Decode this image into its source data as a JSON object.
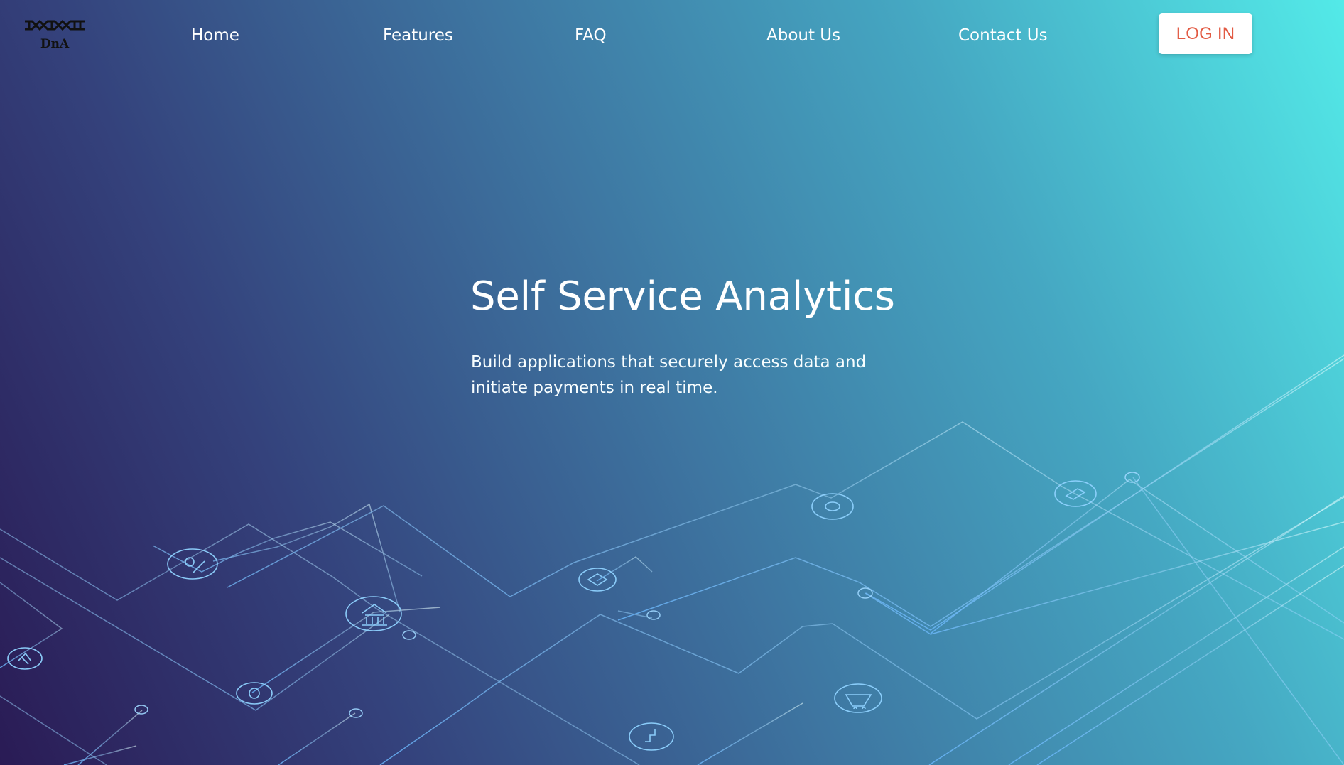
{
  "logo": {
    "text": "DnA"
  },
  "nav": {
    "home": "Home",
    "features": "Features",
    "faq": "FAQ",
    "about": "About Us",
    "contact": "Contact Us",
    "login": "LOG IN"
  },
  "hero": {
    "title": "Self Service Analytics",
    "subtitle": "Build applications that securely access data and initiate payments in real time."
  },
  "theme": {
    "gradient_start": "#2a1b55",
    "gradient_middle": "#3e77a2",
    "gradient_end": "#53eae8",
    "login_text_color": "#e25a43"
  },
  "icons": [
    "dna-logo-icon",
    "user-icon",
    "bank-icon",
    "settings-icon",
    "document-icon",
    "card-icon",
    "coin-icon",
    "cart-icon",
    "chart-icon",
    "service-icon"
  ]
}
